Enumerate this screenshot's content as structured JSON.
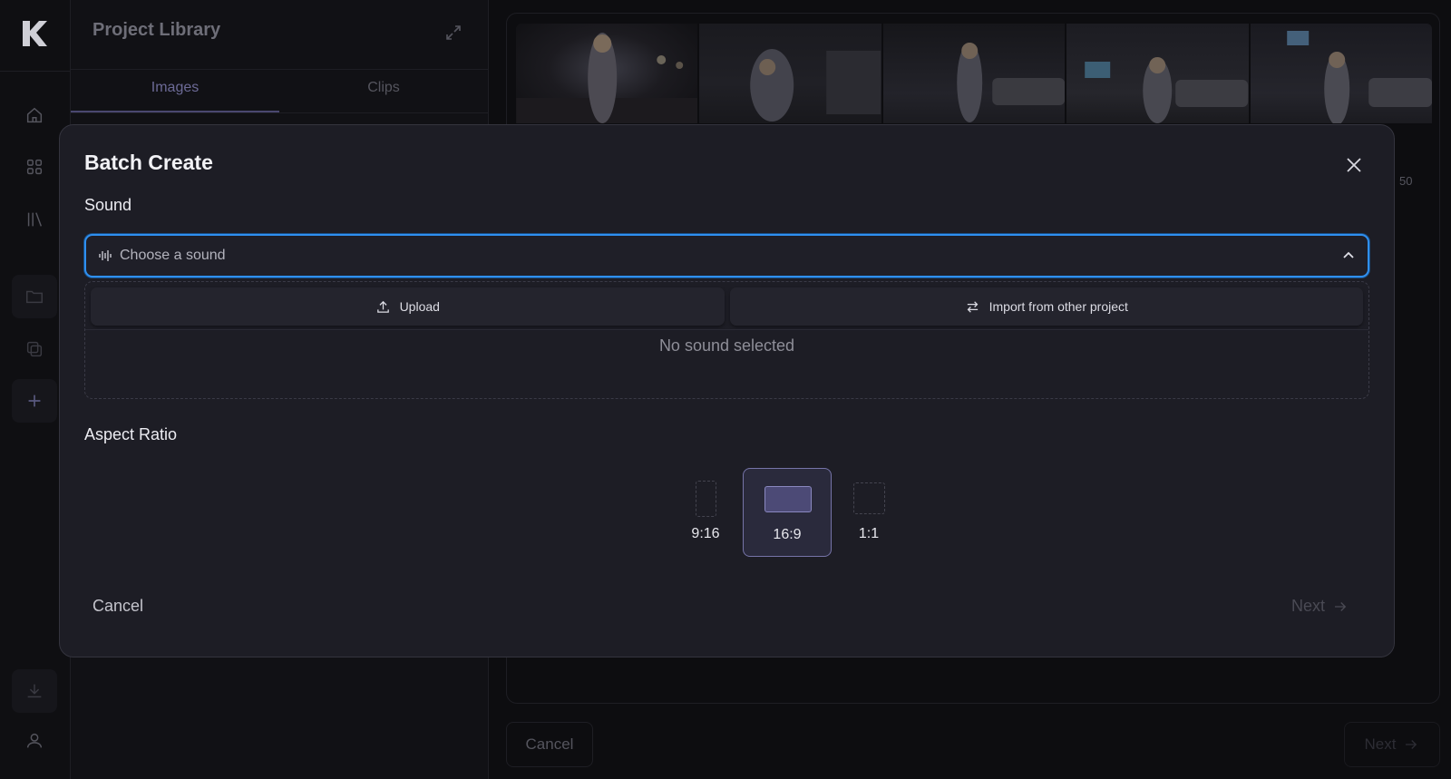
{
  "library": {
    "title": "Project Library",
    "tabs": [
      {
        "label": "Images",
        "active": true
      },
      {
        "label": "Clips",
        "active": false
      }
    ]
  },
  "rail": {
    "icons": [
      "logo-icon",
      "home-icon",
      "grid-icon",
      "library-icon",
      "folder-icon",
      "copy-icon",
      "plus-icon",
      "download-icon",
      "user-icon"
    ]
  },
  "background": {
    "count": "50",
    "cancel_label": "Cancel",
    "next_label": "Next"
  },
  "modal": {
    "title": "Batch Create",
    "sound_section": {
      "label": "Sound",
      "select_placeholder": "Choose a sound",
      "upload_label": "Upload",
      "import_label": "Import from other project",
      "empty_text": "No sound selected"
    },
    "aspect_section": {
      "label": "Aspect Ratio",
      "options": [
        {
          "label": "9:16",
          "selected": false
        },
        {
          "label": "16:9",
          "selected": true
        },
        {
          "label": "1:1",
          "selected": false
        }
      ]
    },
    "cancel_label": "Cancel",
    "next_label": "Next"
  },
  "colors": {
    "accent_focus": "#2f8ff0",
    "selected_ratio": "#4c4a76",
    "modal_bg": "#1d1d25"
  }
}
